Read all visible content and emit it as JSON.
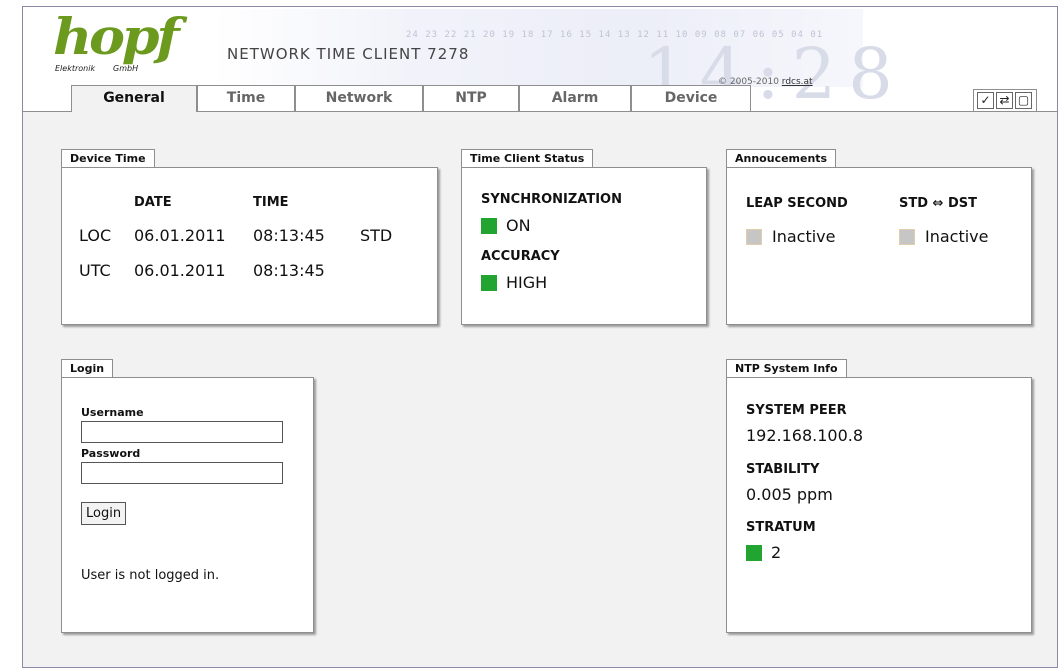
{
  "header": {
    "logo_text": "hopf",
    "logo_sub_left": "Elektronik",
    "logo_sub_right": "GmbH",
    "product_title": "NETWORK TIME CLIENT 7278",
    "copyright_prefix": "© 2005-2010 ",
    "copyright_link": "rdcs.at",
    "scale_digits": "24 23 22 21 20 19 18 17 16 15 14 13 12 11 10 09 08 07 06 05 04 01",
    "background_clock": "14:28"
  },
  "tabs": [
    {
      "label": "General",
      "active": true
    },
    {
      "label": "Time",
      "active": false
    },
    {
      "label": "Network",
      "active": false
    },
    {
      "label": "NTP",
      "active": false
    },
    {
      "label": "Alarm",
      "active": false
    },
    {
      "label": "Device",
      "active": false
    }
  ],
  "toolbar_icons": [
    {
      "name": "check-icon",
      "glyph": "✓"
    },
    {
      "name": "refresh-icon",
      "glyph": "⇄"
    },
    {
      "name": "window-icon",
      "glyph": "▢"
    }
  ],
  "device_time": {
    "title": "Device Time",
    "date_header": "DATE",
    "time_header": "TIME",
    "loc": {
      "label": "LOC",
      "date": "06.01.2011",
      "time": "08:13:45",
      "suffix": "STD"
    },
    "utc": {
      "label": "UTC",
      "date": "06.01.2011",
      "time": "08:13:45"
    }
  },
  "time_client_status": {
    "title": "Time Client Status",
    "sync_label": "SYNCHRONIZATION",
    "sync_value": "ON",
    "accuracy_label": "ACCURACY",
    "accuracy_value": "HIGH"
  },
  "announcements": {
    "title": "Annoucements",
    "leap_label": "LEAP SECOND",
    "leap_value": "Inactive",
    "dst_label": "STD ⇔ DST",
    "dst_value": "Inactive"
  },
  "login": {
    "title": "Login",
    "username_label": "Username",
    "username_value": "",
    "password_label": "Password",
    "password_value": "",
    "button_label": "Login",
    "status": "User is not logged in."
  },
  "ntp_info": {
    "title": "NTP System Info",
    "peer_label": "SYSTEM PEER",
    "peer_value": "192.168.100.8",
    "stability_label": "STABILITY",
    "stability_value": "0.005 ppm",
    "stratum_label": "STRATUM",
    "stratum_value": "2"
  },
  "colors": {
    "logo_green": "#6b9a1f",
    "status_green": "#22a530",
    "inactive_grey": "#c6c6c6",
    "content_bg": "#f2f2f2"
  }
}
